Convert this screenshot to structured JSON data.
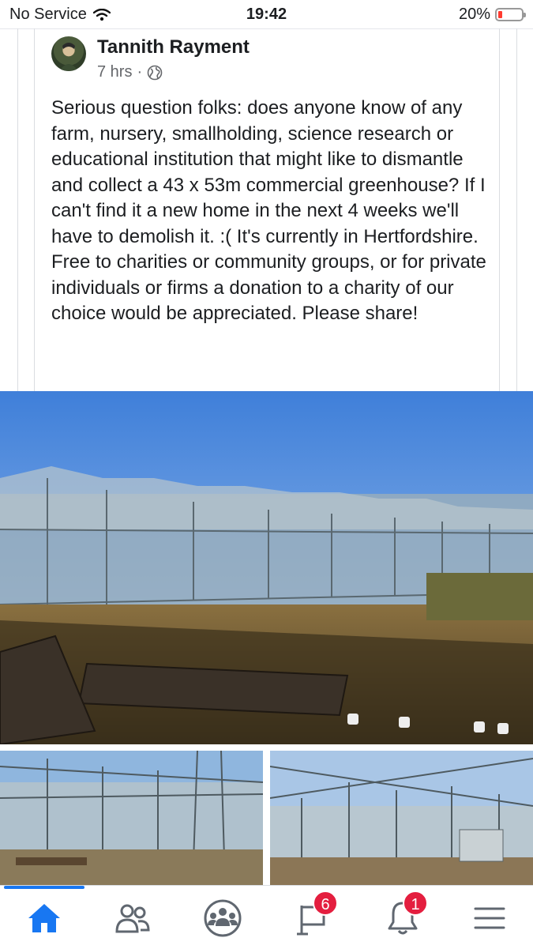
{
  "status_bar": {
    "carrier": "No Service",
    "time": "19:42",
    "battery": "20%",
    "icons": [
      "wifi-icon",
      "battery-icon"
    ],
    "battery_level": 0.2,
    "battery_color": "#ff3b30"
  },
  "post": {
    "author": "Tannith Rayment",
    "time": "7 hrs",
    "separator": "·",
    "privacy_icon": "globe-icon",
    "text": "Serious question folks: does anyone know of any farm, nursery, smallholding, science research or educational institution that might like to dismantle and collect a 43 x 53m commercial greenhouse? If I can't find it a new home in the next 4 weeks we'll have to demolish it. :( It's currently in Hertfordshire. Free to charities or community groups, or for private individuals or firms a donation to a charity of our choice would be appreciated. Please share!"
  },
  "photos": [
    {
      "name": "greenhouse-exterior-photo"
    },
    {
      "name": "greenhouse-interior-photo-1"
    },
    {
      "name": "greenhouse-interior-photo-2"
    }
  ],
  "bottom_nav": {
    "accent": "#1877f2",
    "badge_color": "#e41e3f",
    "items": [
      {
        "icon": "home-icon",
        "active": true
      },
      {
        "icon": "friends-icon"
      },
      {
        "icon": "groups-icon"
      },
      {
        "icon": "pages-flag-icon",
        "badge": "6"
      },
      {
        "icon": "notifications-bell-icon",
        "badge": "1"
      },
      {
        "icon": "menu-icon"
      }
    ]
  }
}
